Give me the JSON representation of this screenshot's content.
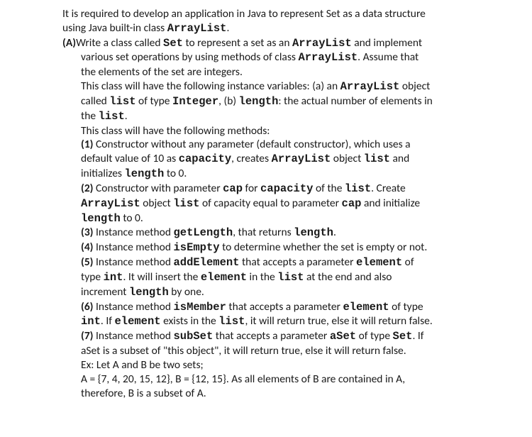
{
  "intro": {
    "l1a": "It is required to develop an application in Java to represent Set as a data structure",
    "l2a": "using Java built-in class ",
    "l2b": "ArrayList",
    "l2c": "."
  },
  "partA": {
    "label": "(A)",
    "l1a": "Write a class called ",
    "l1b": "Set",
    "l1c": " to represent a set as an ",
    "l1d": "ArrayList",
    "l1e": " and implement",
    "l2a": "various set operations by using methods of class ",
    "l2b": "ArrayList",
    "l2c": ". Assume that",
    "l3": "the elements of the set are integers.",
    "l4a": "This class will have the following instance variables: (a) an ",
    "l4b": "ArrayList",
    "l4c": " object",
    "l5a": "called ",
    "l5b": "list",
    "l5c": " of type ",
    "l5d": "Integer",
    "l5e": ", (b) ",
    "l5f": "length",
    "l5g": ": the actual number of elements in",
    "l6a": "the ",
    "l6b": "list",
    "l6c": ".",
    "l7": "This class will have the following methods:"
  },
  "m1": {
    "label": "(1)",
    "l1": " Constructor without any parameter (default constructor), which uses a",
    "l2a": "default value of 10 as ",
    "l2b": "capacity",
    "l2c": ", creates ",
    "l2d": "ArrayList",
    "l2e": "  object ",
    "l2f": "list",
    "l2g": "  and",
    "l3a": "initializes ",
    "l3b": "length",
    "l3c": " to 0."
  },
  "m2": {
    "label": "(2)",
    "l1a": " Constructor with parameter ",
    "l1b": "cap",
    "l1c": " for ",
    "l1d": "capacity",
    "l1e": " of the ",
    "l1f": "list",
    "l1g": ". Create",
    "l2a": "ArrayList",
    "l2b": " object  ",
    "l2c": "list",
    "l2d": "  of capacity equal to parameter ",
    "l2e": "cap",
    "l2f": " and initialize",
    "l3a": "length",
    "l3b": " to 0."
  },
  "m3": {
    "label": "(3)",
    "l1a": " Instance method ",
    "l1b": "getLength",
    "l1c": ", that returns ",
    "l1d": "length",
    "l1e": "."
  },
  "m4": {
    "label": "(4)",
    "l1a": " Instance method ",
    "l1b": "isEmpty",
    "l1c": " to determine whether the set is empty or not."
  },
  "m5": {
    "label": "(5)",
    "l1a": " Instance method ",
    "l1b": "addElement",
    "l1c": " that accepts a parameter ",
    "l1d": "element",
    "l1e": " of",
    "l2a": "type ",
    "l2b": "int",
    "l2c": ". It will insert the ",
    "l2d": "element",
    "l2e": " in the ",
    "l2f": "list",
    "l2g": " at the end and also",
    "l3a": "increment ",
    "l3b": "length",
    "l3c": " by one."
  },
  "m6": {
    "label": "(6)",
    "l1a": " Instance method ",
    "l1b": "isMember",
    "l1c": " that accepts a parameter ",
    "l1d": "element",
    "l1e": " of type",
    "l2a": "int",
    "l2b": ". If ",
    "l2c": "element",
    "l2d": " exists in the ",
    "l2e": "list",
    "l2f": ", it will return true, else it will return false."
  },
  "m7": {
    "label": "(7)",
    "l1a": " Instance method ",
    "l1b": "subSet",
    "l1c": "  that accepts a parameter ",
    "l1d": "aSet",
    "l1e": " of type ",
    "l1f": "Set",
    "l1g": ".  If",
    "l2": "aSet is a subset of \"this object\", it will return true, else it will return false.",
    "l3": " Ex: Let A and B be two sets;",
    "l4": "A = {7, 4, 20, 15, 12}, B = {12, 15}. As all elements of B are contained in A,",
    "l5": "therefore, B is a subset of A."
  }
}
